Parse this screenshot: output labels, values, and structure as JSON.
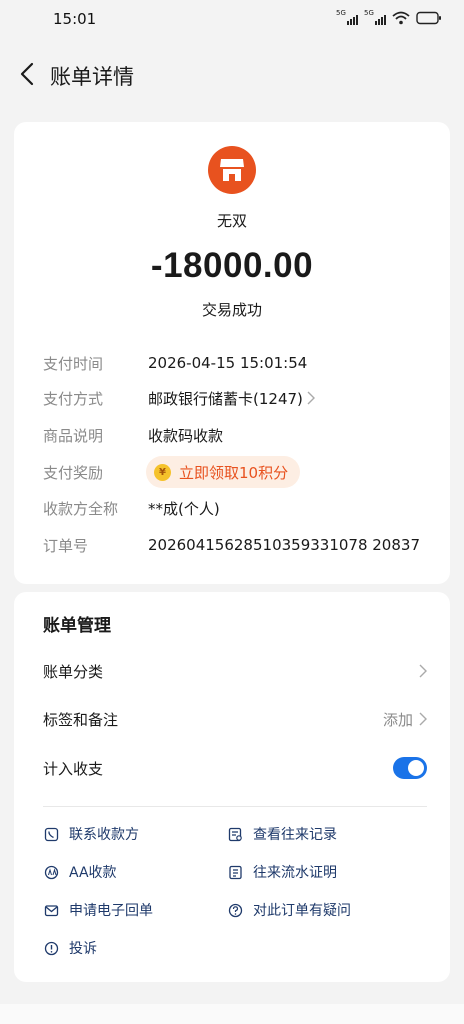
{
  "status_bar": {
    "time": "15:01",
    "sim1_label": "5G",
    "sim2_label": "5G"
  },
  "header": {
    "title": "账单详情"
  },
  "merchant": {
    "name": "无双",
    "amount": "-18000.00",
    "status": "交易成功",
    "logo_color": "#e8521f"
  },
  "details": {
    "pay_time_label": "支付时间",
    "pay_time_value": "2026-04-15 15:01:54",
    "pay_method_label": "支付方式",
    "pay_method_value": "邮政银行储蓄卡(1247)",
    "product_label": "商品说明",
    "product_value": "收款码收款",
    "reward_label": "支付奖励",
    "reward_coin": "¥",
    "reward_value": "立即领取10积分",
    "payee_label": "收款方全称",
    "payee_value": "**成(个人)",
    "order_label": "订单号",
    "order_value": "20260415628510359331078 20837"
  },
  "management": {
    "title": "账单管理",
    "category_label": "账单分类",
    "tags_label": "标签和备注",
    "tags_action": "添加",
    "count_label": "计入收支",
    "count_enabled": true
  },
  "links": {
    "contact": "联系收款方",
    "history": "查看往来记录",
    "aa": "AA收款",
    "statement": "往来流水证明",
    "receipt": "申请电子回单",
    "question": "对此订单有疑问",
    "complaint": "投诉"
  },
  "colors": {
    "accent": "#1a73e8",
    "brand": "#e8521f",
    "link": "#1f3a6b"
  }
}
